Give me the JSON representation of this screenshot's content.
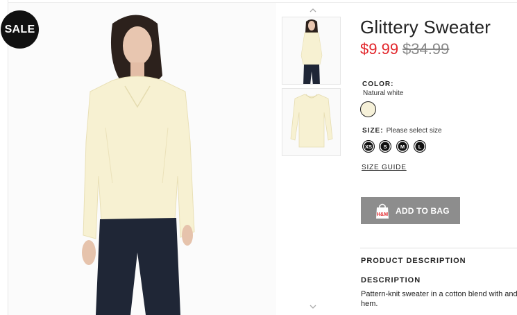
{
  "product": {
    "sale_badge": "SALE",
    "title": "Glittery Sweater",
    "price_sale": "$9.99",
    "price_original": "$34.99"
  },
  "color": {
    "label": "COLOR:",
    "value": "Natural white",
    "swatch_hex": "#f6f1d9"
  },
  "size": {
    "label": "SIZE:",
    "hint": "Please select size",
    "options": [
      "XS",
      "S",
      "M",
      "L"
    ],
    "guide_label": "SIZE GUIDE"
  },
  "actions": {
    "add_to_bag_label": "ADD TO BAG"
  },
  "description": {
    "section_heading": "PRODUCT DESCRIPTION",
    "heading": "DESCRIPTION",
    "text": "Pattern-knit sweater in a cotton blend with and hem."
  },
  "icons": {
    "thumb_up": "chevron-up-icon",
    "thumb_down": "chevron-down-icon",
    "bag": "shopping-bag-icon"
  },
  "colors": {
    "sale_price": "#e2262b",
    "button_bg": "#8d8d8d",
    "badge_bg": "#111111"
  }
}
